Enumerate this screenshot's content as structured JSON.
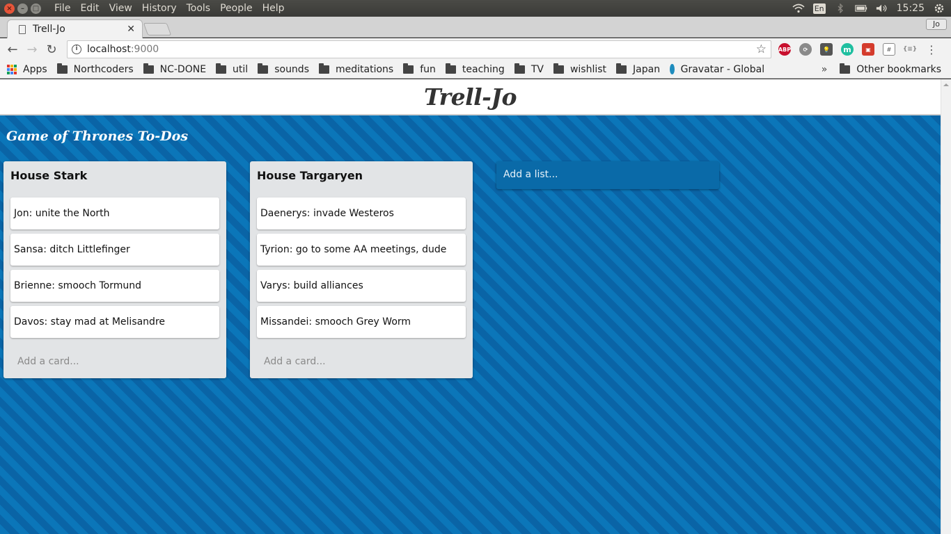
{
  "os": {
    "menu": [
      "File",
      "Edit",
      "View",
      "History",
      "Tools",
      "People",
      "Help"
    ],
    "lang": "En",
    "clock": "15:25"
  },
  "browser": {
    "tab_title": "Trell-Jo",
    "profile": "Jo",
    "url_host": "localhost",
    "url_port": ":9000",
    "extensions": [
      "ABP",
      "sync",
      "lightbulb",
      "m",
      "pic",
      "grid",
      "json"
    ],
    "bookmarks": [
      "Apps",
      "Northcoders",
      "NC-DONE",
      "util",
      "sounds",
      "meditations",
      "fun",
      "teaching",
      "TV",
      "wishlist",
      "Japan",
      "Gravatar - Global"
    ],
    "more": "»",
    "other_bookmarks": "Other bookmarks"
  },
  "app": {
    "title": "Trell-Jo",
    "board_title": "Game of Thrones To-Dos",
    "lists": [
      {
        "title": "House Stark",
        "cards": [
          "Jon: unite the North",
          "Sansa: ditch Littlefinger",
          "Brienne: smooch Tormund",
          "Davos: stay mad at Melisandre"
        ],
        "add_card": "Add a card..."
      },
      {
        "title": "House Targaryen",
        "cards": [
          "Daenerys: invade Westeros",
          "Tyrion: go to some AA meetings, dude",
          "Varys: build alliances",
          "Missandei: smooch Grey Worm"
        ],
        "add_card": "Add a card..."
      }
    ],
    "add_list": "Add a list..."
  },
  "colors": {
    "stripe_light": "#0b76b9",
    "stripe_dark": "#0a64a6",
    "list_bg": "#e2e4e6"
  }
}
